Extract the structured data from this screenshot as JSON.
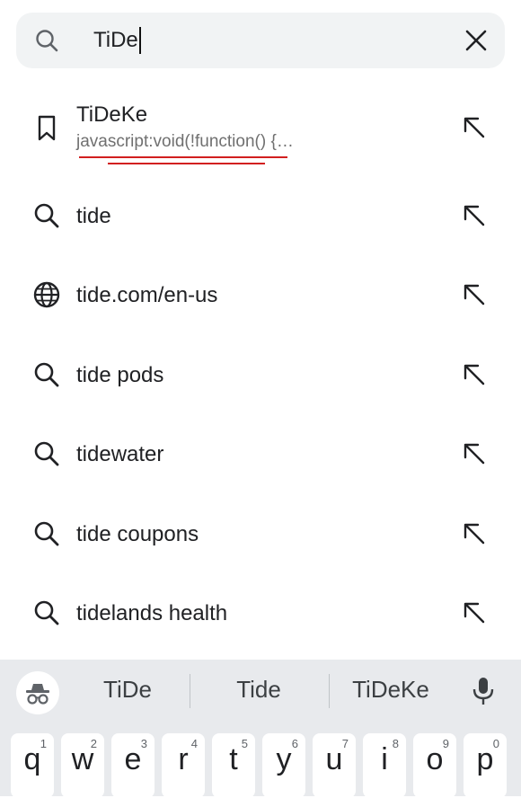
{
  "search": {
    "query": "TiDe"
  },
  "suggestions": [
    {
      "icon": "bookmark-icon",
      "title": "TiDeKe",
      "subtitle": "javascript:void(!function() {…"
    },
    {
      "icon": "search-icon",
      "title": "tide"
    },
    {
      "icon": "globe-icon",
      "title": "tide.com/en-us"
    },
    {
      "icon": "search-icon",
      "title": "tide pods"
    },
    {
      "icon": "search-icon",
      "title": "tidewater"
    },
    {
      "icon": "search-icon",
      "title": "tide coupons"
    },
    {
      "icon": "search-icon",
      "title": "tidelands health"
    }
  ],
  "keyboard": {
    "suggestions": [
      "TiDe",
      "Tide",
      "TiDeKe"
    ],
    "keys": [
      {
        "char": "q",
        "num": "1"
      },
      {
        "char": "w",
        "num": "2"
      },
      {
        "char": "e",
        "num": "3"
      },
      {
        "char": "r",
        "num": "4"
      },
      {
        "char": "t",
        "num": "5"
      },
      {
        "char": "y",
        "num": "6"
      },
      {
        "char": "u",
        "num": "7"
      },
      {
        "char": "i",
        "num": "8"
      },
      {
        "char": "o",
        "num": "9"
      },
      {
        "char": "p",
        "num": "0"
      }
    ]
  },
  "colors": {
    "annotation_underline": "#d21f1f",
    "search_bg": "#f1f3f4",
    "keyboard_bg": "#e8eaed"
  }
}
